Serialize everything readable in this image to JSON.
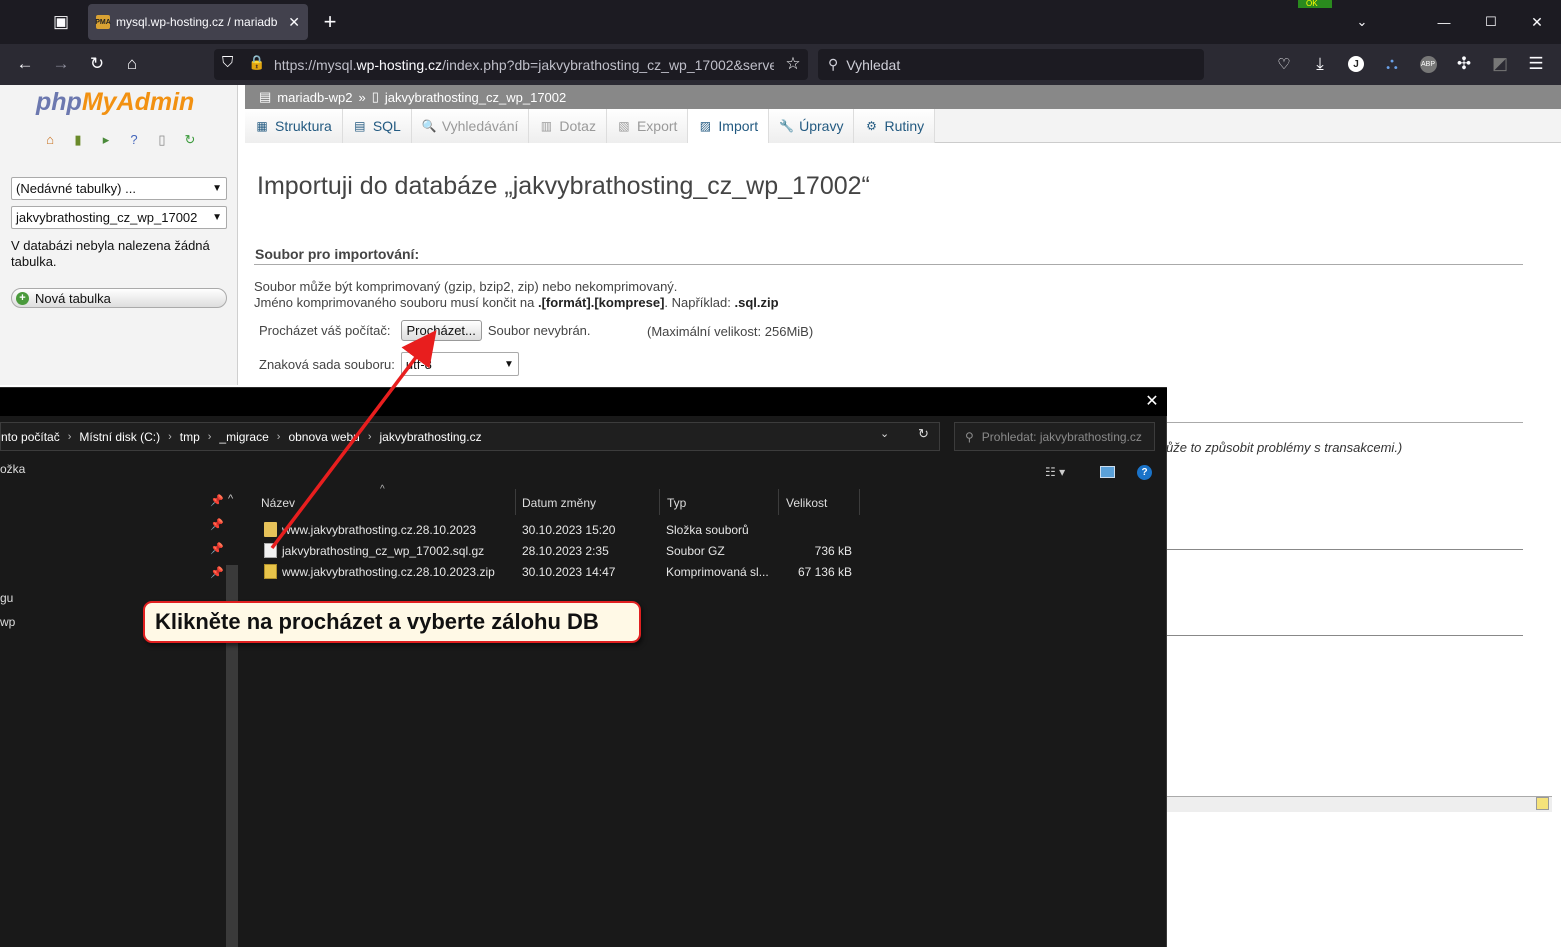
{
  "browser": {
    "tab_title": "mysql.wp-hosting.cz / mariadb",
    "tab_favicon": "PMA",
    "new_tab": "+",
    "url_prefix": "https://mysql.",
    "url_domain": "wp-hosting.cz",
    "url_suffix": "/index.php?db=jakvybrathosting_cz_wp_17002&server",
    "search_placeholder": "Vyhledat",
    "extension_badge": "OK",
    "colors": {
      "tabbar": "#1c1b22",
      "navbar": "#2b2a33"
    }
  },
  "pma_sidebar": {
    "logo_php": "php",
    "logo_myadmin": "MyAdmin",
    "recent_tables": "(Nedávné tabulky) ...",
    "database_select": "jakvybrathosting_cz_wp_17002",
    "no_tables": "V databázi nebyla nalezena žádná tabulka.",
    "new_table": "Nová tabulka"
  },
  "pma_main": {
    "breadcrumb_server": "mariadb-wp2",
    "breadcrumb_sep": "»",
    "breadcrumb_db": "jakvybrathosting_cz_wp_17002",
    "tabs": [
      {
        "label": "Struktura",
        "icon": "structure-icon",
        "glyph": "▦",
        "state": "normal"
      },
      {
        "label": "SQL",
        "icon": "sql-icon",
        "glyph": "▤",
        "state": "normal"
      },
      {
        "label": "Vyhledávání",
        "icon": "search-icon",
        "glyph": "🔍",
        "state": "disabled"
      },
      {
        "label": "Dotaz",
        "icon": "query-icon",
        "glyph": "▥",
        "state": "disabled"
      },
      {
        "label": "Export",
        "icon": "export-icon",
        "glyph": "▧",
        "state": "disabled"
      },
      {
        "label": "Import",
        "icon": "import-icon",
        "glyph": "▨",
        "state": "active"
      },
      {
        "label": "Úpravy",
        "icon": "wrench-icon",
        "glyph": "🔧",
        "state": "normal"
      },
      {
        "label": "Rutiny",
        "icon": "routines-icon",
        "glyph": "⚙",
        "state": "normal"
      }
    ],
    "heading": "Importuji do databáze „jakvybrathosting_cz_wp_17002“",
    "section_file": "Soubor pro importování:",
    "desc_line1": "Soubor může být komprimovaný (gzip, bzip2, zip) nebo nekomprimovaný.",
    "desc_line2_a": "Jméno komprimovaného souboru musí končit na ",
    "desc_line2_b": ".[formát].[komprese]",
    "desc_line2_c": ". Například: ",
    "desc_line2_d": ".sql.zip",
    "browse_label": "Procházet váš počítač:",
    "browse_button": "Procházet...",
    "no_file": "Soubor nevybrán.",
    "max_size": "(Maximální velikost: 256MiB)",
    "charset_label": "Znaková sada souboru:",
    "charset_value": "utf-8",
    "partial_text": "ůže to způsobit problémy s transakcemi.)"
  },
  "file_dialog": {
    "address": [
      "nto počítač",
      "Místní disk (C:)",
      "tmp",
      "_migrace",
      "obnova webu",
      "jakvybrathosting.cz"
    ],
    "search_placeholder": "Prohledat: jakvybrathosting.cz",
    "toolbar_partial": "ožka",
    "nav_partial": [
      "gu",
      "wp"
    ],
    "columns": {
      "name": "Název",
      "date": "Datum změny",
      "type": "Typ",
      "size": "Velikost"
    },
    "files": [
      {
        "name": "www.jakvybrathosting.cz.28.10.2023",
        "date": "30.10.2023 15:20",
        "type": "Složka souborů",
        "size": "",
        "icon": "folder-icon"
      },
      {
        "name": "jakvybrathosting_cz_wp_17002.sql.gz",
        "date": "28.10.2023 2:35",
        "type": "Soubor GZ",
        "size": "736 kB",
        "icon": "gz-file-icon"
      },
      {
        "name": "www.jakvybrathosting.cz.28.10.2023.zip",
        "date": "30.10.2023 14:47",
        "type": "Komprimovaná sl...",
        "size": "67 136 kB",
        "icon": "zip-file-icon"
      }
    ]
  },
  "annotation": {
    "callout": "Klikněte na procházet a vyberte zálohu DB",
    "arrow_color": "#e81e1e"
  }
}
